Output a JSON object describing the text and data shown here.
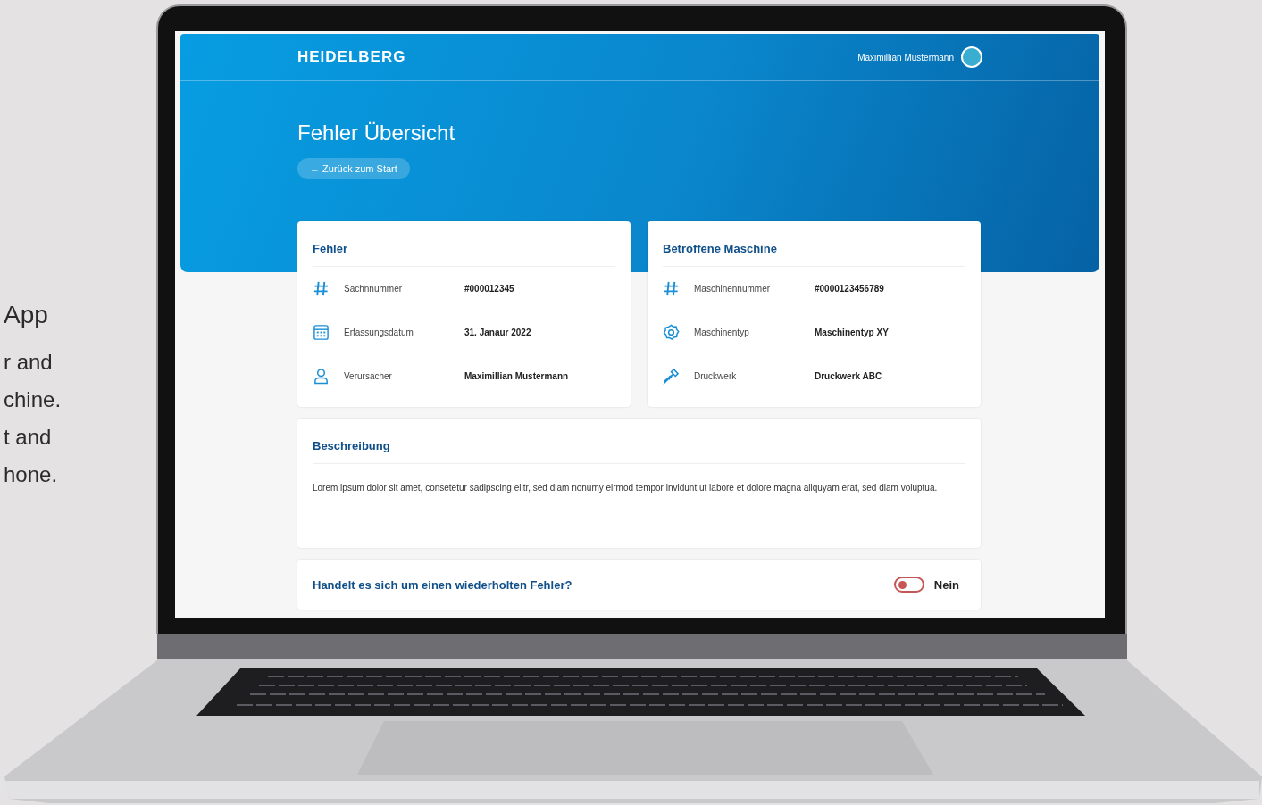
{
  "slide": {
    "heading": "App",
    "lines": [
      "r and",
      "chine.",
      "t and",
      "hone."
    ]
  },
  "header": {
    "logo": "HEIDELBERG",
    "user_name": "Maximillian Mustermann"
  },
  "page": {
    "title": "Fehler Übersicht",
    "back_button": "← Zurück zum Start"
  },
  "cards": [
    {
      "title": "Fehler",
      "rows": [
        {
          "kind": "hash",
          "label": "Sachnnummer",
          "value": "#000012345"
        },
        {
          "kind": "calendar",
          "label": "Erfassungsdatum",
          "value": "31. Janaur 2022"
        },
        {
          "kind": "user",
          "label": "Verursacher",
          "value": "Maximillian Mustermann"
        }
      ]
    },
    {
      "title": "Betroffene Maschine",
      "rows": [
        {
          "kind": "hash",
          "label": "Maschinennummer",
          "value": "#0000123456789"
        },
        {
          "kind": "gear",
          "label": "Maschinentyp",
          "value": "Maschinentyp XY"
        },
        {
          "kind": "screw",
          "label": "Druckwerk",
          "value": "Druckwerk ABC"
        }
      ]
    }
  ],
  "description": {
    "title": "Beschreibung",
    "text": "Lorem ipsum dolor sit amet, consetetur sadipscing elitr, sed diam nonumy eirmod tempor invidunt ut labore et dolore magna aliquyam erat, sed diam voluptua."
  },
  "repeat_question": {
    "question": "Handelt es sich um einen wiederholten Fehler?",
    "on": false,
    "answer": "Nein"
  }
}
